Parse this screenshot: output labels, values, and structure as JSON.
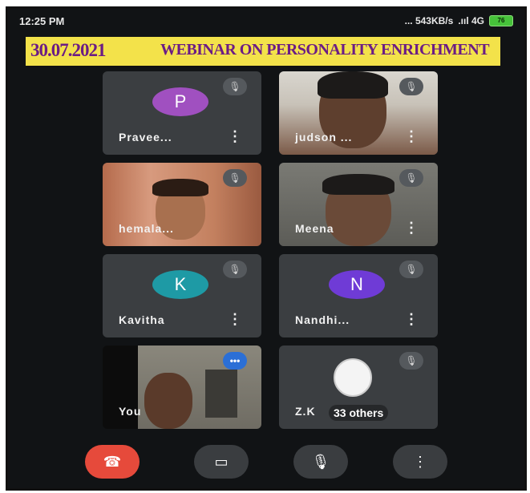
{
  "status": {
    "time": "12:25 PM",
    "right": "... 543KB/s",
    "network": ".ııl 4G",
    "battery": "76"
  },
  "meet": {
    "code": "tpa-b"
  },
  "banner": {
    "date": "30.07.2021",
    "title": "WEBINAR ON PERSONALITY ENRICHMENT",
    "colors": {
      "background": "#f3e24a",
      "text": "#6b1c85"
    }
  },
  "participants": [
    {
      "name": "Pravee...",
      "initial": "P",
      "avatar_color": "#a050c0",
      "muted": true
    },
    {
      "name": "judson ...",
      "video": true,
      "muted": true
    },
    {
      "name": "hemala...",
      "video": true,
      "muted": true
    },
    {
      "name": "Meena",
      "video": true,
      "muted": true
    },
    {
      "name": "Kavitha",
      "initial": "K",
      "avatar_color": "#1e9aa5",
      "muted": true
    },
    {
      "name": "Nandhi...",
      "initial": "N",
      "avatar_color": "#6f3bd6",
      "muted": true
    },
    {
      "name": "You",
      "video": true
    },
    {
      "name": "Z.K",
      "others": "33 others",
      "muted": true
    }
  ],
  "controls": {
    "end_call": "end-call-icon",
    "camera": "camera-icon",
    "mic": "mic-icon",
    "more": "more-icon"
  },
  "icons": {
    "more": "⋮",
    "mute": "🎙̸",
    "self_more": "•••"
  }
}
